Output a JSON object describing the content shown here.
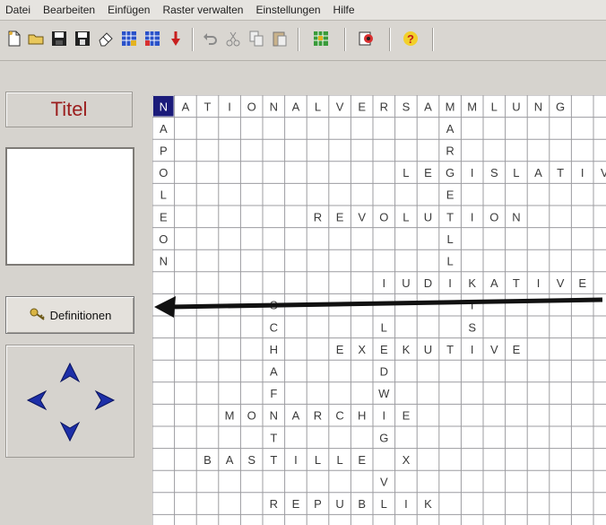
{
  "menu": {
    "items": [
      "Datei",
      "Bearbeiten",
      "Einfügen",
      "Raster verwalten",
      "Einstellungen",
      "Hilfe"
    ]
  },
  "toolbar": {
    "icons": [
      "new-document-icon",
      "open-folder-icon",
      "save-icon",
      "save-as-icon",
      "eraser-icon",
      "grid-icon",
      "grid-alt-icon",
      "pin-icon",
      "undo-icon",
      "cut-icon",
      "copy-icon",
      "paste-icon",
      "puzzle-grid-icon",
      "export-icon",
      "help-icon"
    ]
  },
  "left_panel": {
    "title": "Titel",
    "definitions_button": "Definitionen"
  },
  "navigation": [
    "arrow-up",
    "arrow-left",
    "arrow-right",
    "arrow-down"
  ],
  "crossword": {
    "rows": [
      "NATIONALVERSAMMLUNG  ",
      "A            A        ",
      "P            R        ",
      "O          LEGISLATIVE",
      "L            E        ",
      "E      REVOLUTION     ",
      "O            L        ",
      "N            L        ",
      "          IUDIKATIVE  ",
      "     S        I       ",
      "     C    L   S       ",
      "     H  EXEKUTIVE     ",
      "     A    D           ",
      "     F    W           ",
      "   MONARCHIE          ",
      "     T    G           ",
      "  BASTILLE X           ",
      "          V           ",
      "     REPUBLIK         "
    ],
    "highlight": "N"
  },
  "colors": {
    "title_text": "#9b1d1d",
    "grid_line": "#9c9ca0",
    "letter": "#3a3a3a",
    "highlight_bg": "#1b1b7a",
    "arrow_blue": "#1d2fa8"
  }
}
